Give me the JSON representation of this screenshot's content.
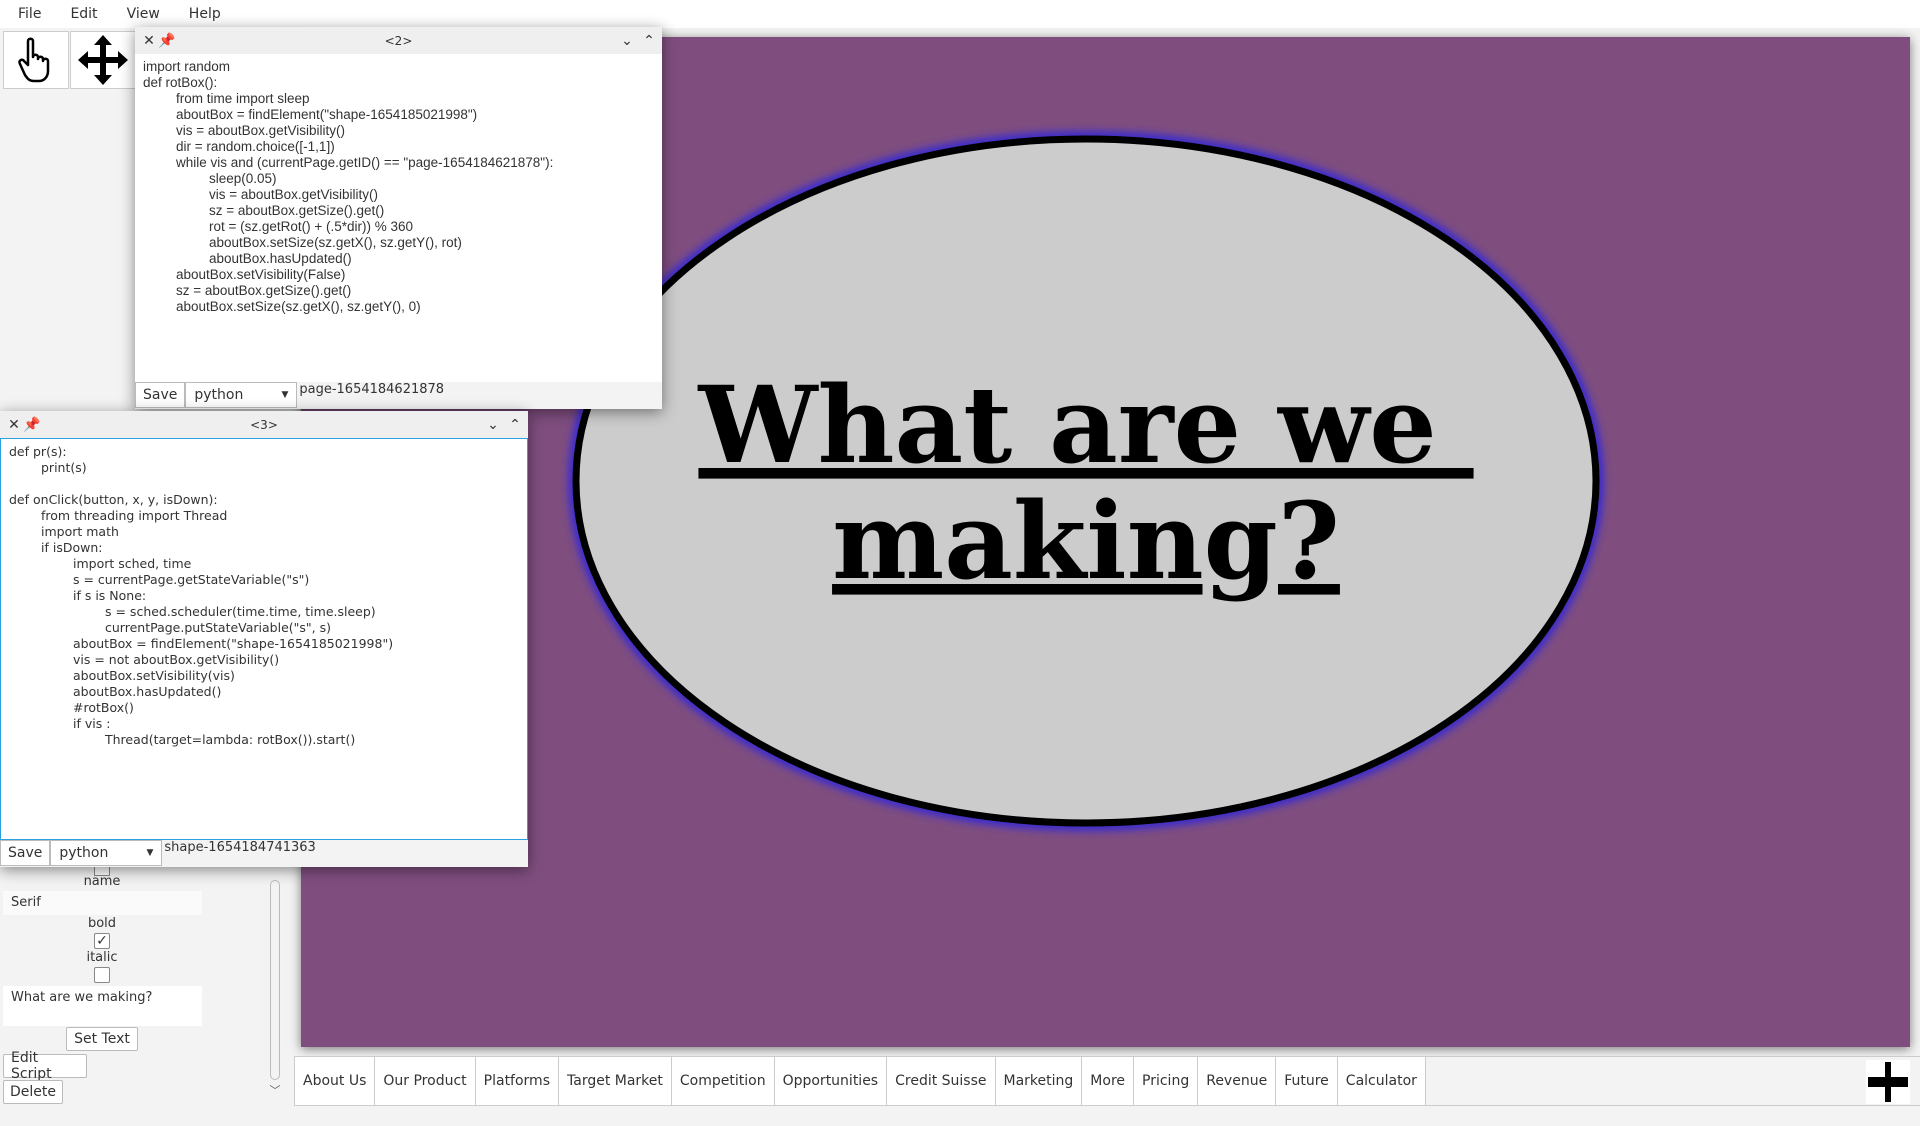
{
  "menu": [
    "File",
    "Edit",
    "View",
    "Help"
  ],
  "tools": [
    {
      "icon": "hand-pointer-icon"
    },
    {
      "icon": "move-arrows-icon"
    }
  ],
  "properties": {
    "name_label": "name",
    "font_name": "Serif",
    "bold_label": "bold",
    "bold_checked": true,
    "italic_label": "italic",
    "italic_checked": false,
    "text_value": "What are we making?",
    "set_text": "Set Text",
    "edit_script": "Edit Script",
    "delete": "Delete"
  },
  "canvas": {
    "background": "#7f4e7f",
    "ellipse_fill": "#cccccc",
    "ellipse_stroke": "#000000",
    "glow": "#3a2ad0",
    "line1": "What are we ",
    "line2": "making?"
  },
  "tabs": [
    "About Us",
    "Our Product",
    "Platforms",
    "Target Market",
    "Competition",
    "Opportunities",
    "Credit Suisse",
    "Marketing",
    "More",
    "Pricing",
    "Revenue",
    "Future",
    "Calculator"
  ],
  "script_windows": [
    {
      "title": "<2>",
      "save": "Save",
      "language": "python",
      "target": "page-1654184621878",
      "code": "import random\ndef rotBox():\n\tfrom time import sleep\n\taboutBox = findElement(\"shape-1654185021998\")\n\tvis = aboutBox.getVisibility()\n\tdir = random.choice([-1,1])\n\twhile vis and (currentPage.getID() == \"page-1654184621878\"):\n\t\tsleep(0.05)\n\t\tvis = aboutBox.getVisibility()\n\t\tsz = aboutBox.getSize().get()\n\t\trot = (sz.getRot() + (.5*dir)) % 360\n\t\taboutBox.setSize(sz.getX(), sz.getY(), rot)\n\t\taboutBox.hasUpdated()\n\taboutBox.setVisibility(False)\n\tsz = aboutBox.getSize().get()\n\taboutBox.setSize(sz.getX(), sz.getY(), 0)"
    },
    {
      "title": "<3>",
      "save": "Save",
      "language": "python",
      "target": "shape-1654184741363",
      "code": "def pr(s):\n\tprint(s)\n\ndef onClick(button, x, y, isDown):\n\tfrom threading import Thread\n\timport math\n\tif isDown:\n\t\timport sched, time\n\t\ts = currentPage.getStateVariable(\"s\")\n\t\tif s is None:\n\t\t\ts = sched.scheduler(time.time, time.sleep)\n\t\t\tcurrentPage.putStateVariable(\"s\", s)\n\t\taboutBox = findElement(\"shape-1654185021998\")\n\t\tvis = not aboutBox.getVisibility()\n\t\taboutBox.setVisibility(vis)\n\t\taboutBox.hasUpdated()\n\t\t#rotBox()\n\t\tif vis :\n\t\t\tThread(target=lambda: rotBox()).start()"
    }
  ]
}
